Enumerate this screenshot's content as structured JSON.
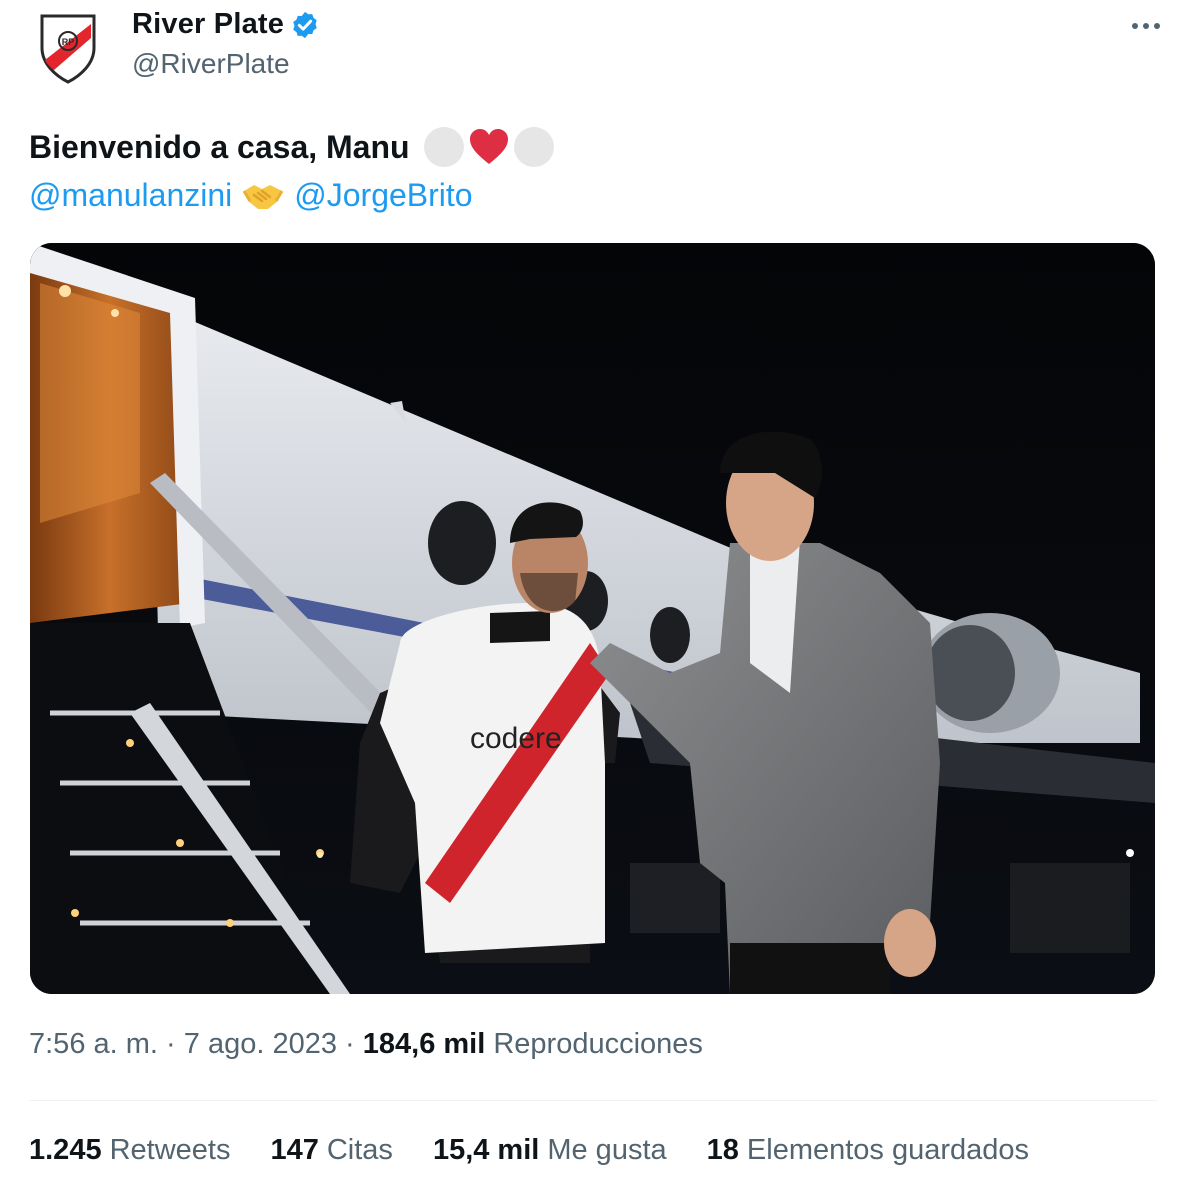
{
  "account": {
    "name": "River Plate",
    "handle": "@RiverPlate",
    "verified": true
  },
  "tweet": {
    "text": "Bienvenido a casa, Manu",
    "emojis": [
      "white-circle-emoji",
      "red-heart-emoji",
      "white-circle-emoji"
    ],
    "mentions": [
      "@manulanzini",
      "@JorgeBrito"
    ],
    "separator_emoji": "handshake-emoji"
  },
  "media": {
    "jersey_sponsor": "codere",
    "description_icon": "photo"
  },
  "meta": {
    "time": "7:56 a. m.",
    "sep1": "·",
    "date": "7 ago. 2023",
    "sep2": "·",
    "views_count": "184,6 mil",
    "views_label": "Reproducciones"
  },
  "stats": [
    {
      "count": "1.245",
      "label": "Retweets"
    },
    {
      "count": "147",
      "label": "Citas"
    },
    {
      "count": "15,4 mil",
      "label": "Me gusta"
    },
    {
      "count": "18",
      "label": "Elementos guardados"
    }
  ],
  "colors": {
    "link": "#1d9bf0",
    "text": "#0f1419",
    "secondary": "#536471",
    "verified": "#1d9bf0",
    "river_red": "#e3262d"
  }
}
